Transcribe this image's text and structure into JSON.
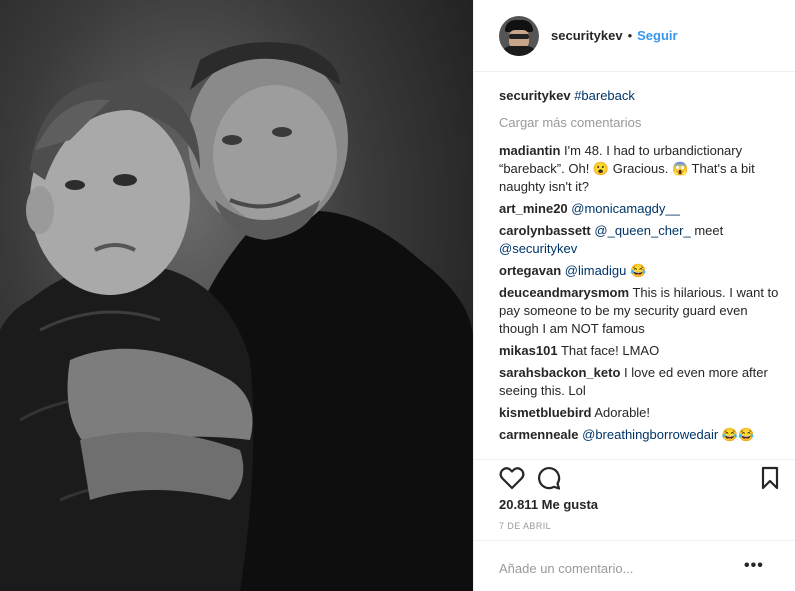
{
  "header": {
    "username": "securitykev",
    "separator": "•",
    "follow_label": "Seguir"
  },
  "caption": {
    "username": "securitykev",
    "text": "#bareback"
  },
  "load_more": "Cargar más comentarios",
  "comments": [
    {
      "user": "madiantin",
      "text": "I'm 48. I had to urbandictionary “bareback”. Oh! 😮 Gracious. 😱 That's a bit naughty isn't it?"
    },
    {
      "user": "art_mine20",
      "mention": "@monicamagdy__",
      "text": ""
    },
    {
      "user": "carolynbassett",
      "mention": "@_queen_cher_",
      "text": " meet ",
      "mention2": "@securitykev"
    },
    {
      "user": "ortegavan",
      "mention": "@limadigu",
      "text": " 😂"
    },
    {
      "user": "deuceandmarysmom",
      "text": "This is hilarious. I want to pay someone to be my security guard even though I am NOT famous"
    },
    {
      "user": "mikas101",
      "text": "That face! LMAO"
    },
    {
      "user": "sarahsbackon_keto",
      "text": "I love ed even more after seeing this. Lol"
    },
    {
      "user": "kismetbluebird",
      "text": "Adorable!"
    },
    {
      "user": "carmenneale",
      "mention": "@breathingborrowedair",
      "text": " 😂😂"
    }
  ],
  "actions": {
    "like_icon": "heart-icon",
    "comment_icon": "comment-icon",
    "save_icon": "bookmark-icon"
  },
  "likes": "20.811 Me gusta",
  "date": "7 DE ABRIL",
  "add_comment": {
    "placeholder": "Añade un comentario...",
    "more_label": "•••"
  },
  "colors": {
    "link": "#003569",
    "follow": "#3897f0",
    "muted": "#999999"
  }
}
